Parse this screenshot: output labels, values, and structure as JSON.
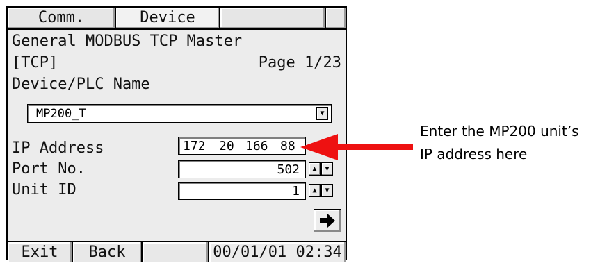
{
  "tabs": [
    "Comm.",
    "Device",
    "",
    ""
  ],
  "header": {
    "title": "General MODBUS TCP Master",
    "protocol": "[TCP]",
    "page": "Page 1/23",
    "device_label": "Device/PLC Name"
  },
  "device_select": {
    "value": "MP200_T"
  },
  "fields": {
    "ip": {
      "label": "IP Address",
      "octets": [
        "172",
        "20",
        "166",
        "88"
      ]
    },
    "port": {
      "label": "Port No.",
      "value": "502"
    },
    "unit": {
      "label": "Unit ID",
      "value": "1"
    }
  },
  "next_icon": "right-arrow-icon",
  "bottom": {
    "exit": "Exit",
    "back": "Back",
    "empty": "",
    "clock": "00/01/01 02:34"
  },
  "annotation": {
    "line1": "Enter the MP200 unit’s",
    "line2": "IP address here"
  },
  "colors": {
    "arrow": "#ee1111",
    "panel": "#ececec"
  }
}
